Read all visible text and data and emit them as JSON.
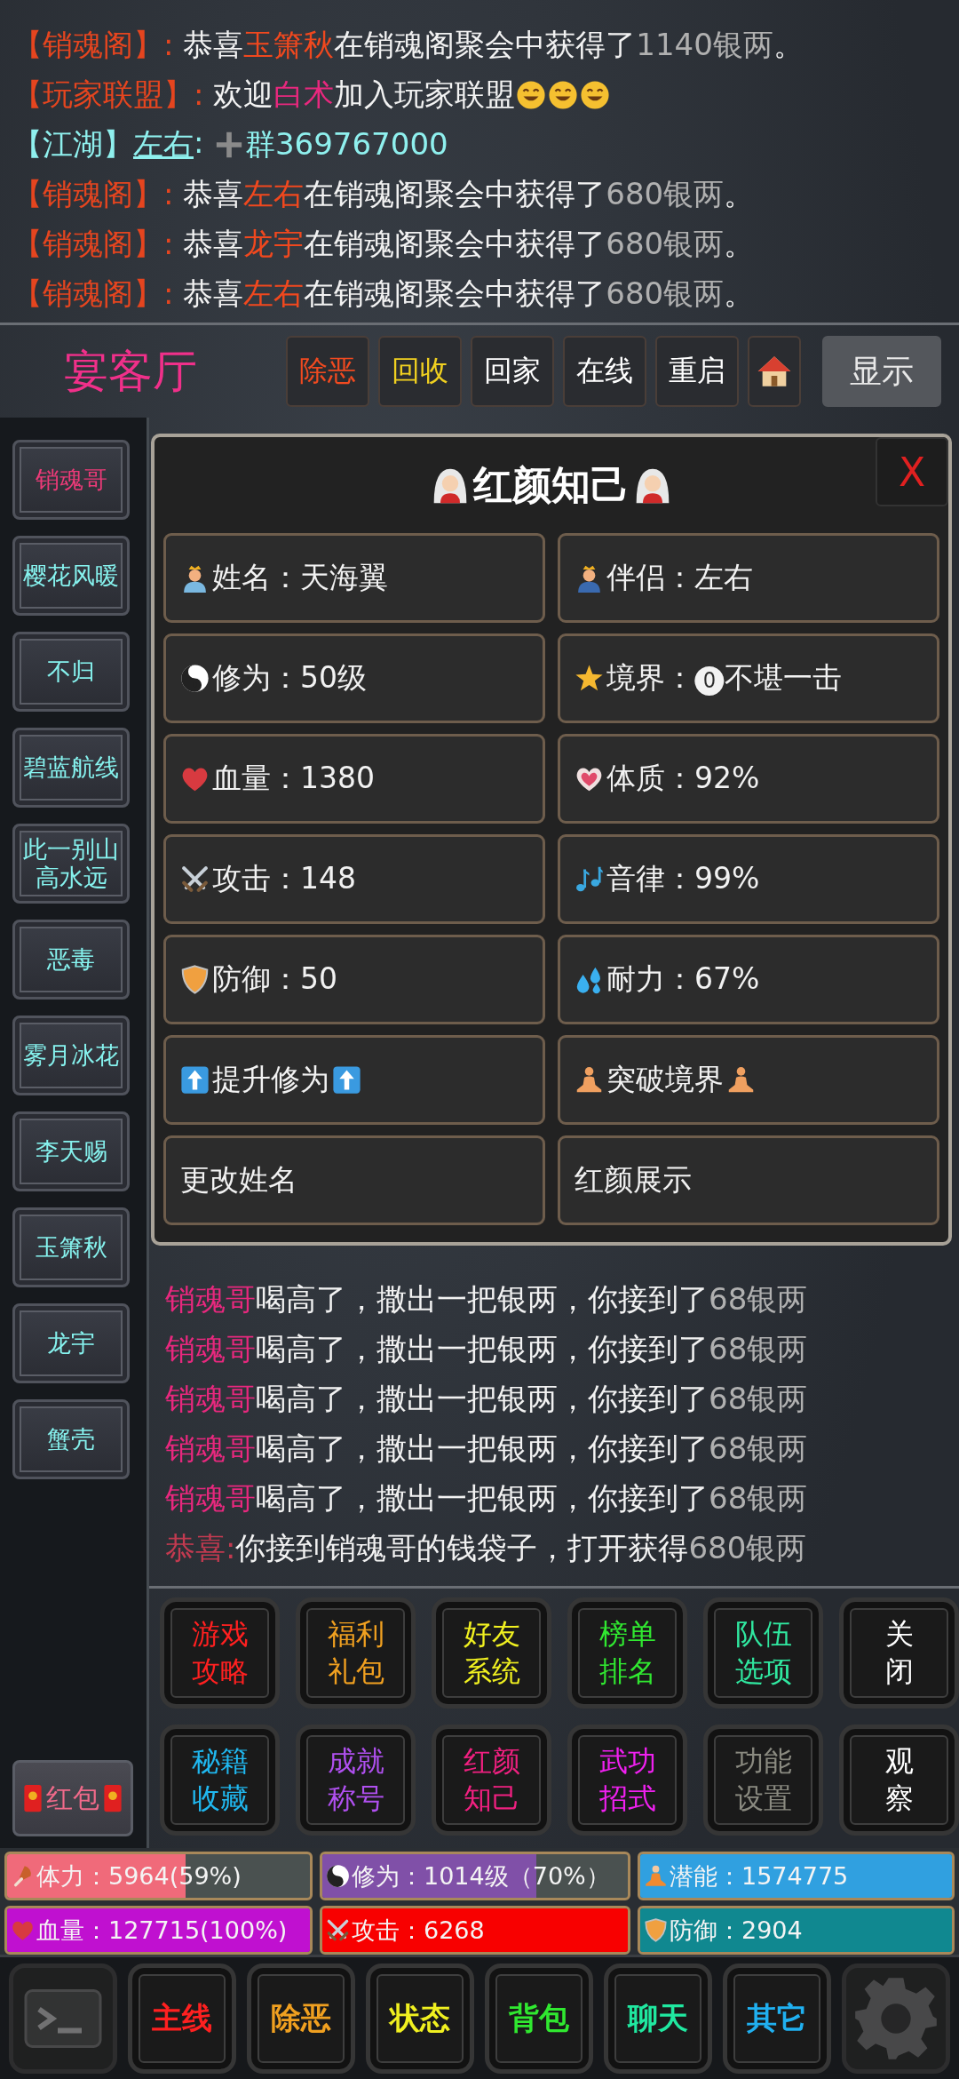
{
  "chat_top": [
    {
      "segments": [
        {
          "kind": "channel",
          "text": "【销魂阁】:"
        },
        {
          "kind": "text",
          "text": " 恭喜"
        },
        {
          "kind": "name",
          "text": "玉箫秋"
        },
        {
          "kind": "text",
          "text": "在销魂阁聚会中获得了"
        },
        {
          "kind": "amount",
          "text": "1140银两"
        },
        {
          "kind": "text",
          "text": "。"
        }
      ]
    },
    {
      "segments": [
        {
          "kind": "channel",
          "text": "【玩家联盟】:"
        },
        {
          "kind": "text",
          "text": " 欢迎"
        },
        {
          "kind": "pink-name",
          "text": "白术"
        },
        {
          "kind": "text",
          "text": "加入玩家联盟"
        },
        {
          "kind": "smiley"
        },
        {
          "kind": "smiley"
        },
        {
          "kind": "smiley"
        }
      ]
    },
    {
      "segments": [
        {
          "kind": "jianghu",
          "text": "【江湖】"
        },
        {
          "kind": "link",
          "text": "左右"
        },
        {
          "kind": "jianghu",
          "text": ": "
        },
        {
          "kind": "plus"
        },
        {
          "kind": "jianghu",
          "text": "群369767000"
        }
      ]
    },
    {
      "segments": [
        {
          "kind": "channel",
          "text": "【销魂阁】:"
        },
        {
          "kind": "text",
          "text": " 恭喜"
        },
        {
          "kind": "name",
          "text": "左右"
        },
        {
          "kind": "text",
          "text": "在销魂阁聚会中获得了"
        },
        {
          "kind": "amount",
          "text": "680银两"
        },
        {
          "kind": "text",
          "text": "。"
        }
      ]
    },
    {
      "segments": [
        {
          "kind": "channel",
          "text": "【销魂阁】:"
        },
        {
          "kind": "text",
          "text": " 恭喜"
        },
        {
          "kind": "name",
          "text": "龙宇"
        },
        {
          "kind": "text",
          "text": "在销魂阁聚会中获得了"
        },
        {
          "kind": "amount",
          "text": "680银两"
        },
        {
          "kind": "text",
          "text": "。"
        }
      ]
    },
    {
      "segments": [
        {
          "kind": "channel",
          "text": "【销魂阁】:"
        },
        {
          "kind": "text",
          "text": " 恭喜"
        },
        {
          "kind": "name",
          "text": "左右"
        },
        {
          "kind": "text",
          "text": "在销魂阁聚会中获得了"
        },
        {
          "kind": "amount",
          "text": "680银两"
        },
        {
          "kind": "text",
          "text": "。"
        }
      ]
    }
  ],
  "header": {
    "title": "宴客厅",
    "buttons": [
      {
        "label": "除恶",
        "color": "#f04a20"
      },
      {
        "label": "回收",
        "color": "#f0d020"
      },
      {
        "label": "回家",
        "color": "#ffffff"
      },
      {
        "label": "在线",
        "color": "#ffffff"
      },
      {
        "label": "重启",
        "color": "#ffffff"
      }
    ],
    "show_button": "显示"
  },
  "sidebar": {
    "items": [
      {
        "label": "销魂哥",
        "selected": true
      },
      {
        "label": "樱花风暖",
        "selected": false
      },
      {
        "label": "不归",
        "selected": false
      },
      {
        "label": "碧蓝航线",
        "selected": false
      },
      {
        "label": "此一别山高水远",
        "selected": false
      },
      {
        "label": "恶毒",
        "selected": false
      },
      {
        "label": "雾月冰花",
        "selected": false
      },
      {
        "label": "李天赐",
        "selected": false
      },
      {
        "label": "玉箫秋",
        "selected": false
      },
      {
        "label": "龙宇",
        "selected": false
      },
      {
        "label": "蟹壳",
        "selected": false
      }
    ],
    "red_packet": "红包"
  },
  "modal": {
    "title": "红颜知己",
    "close": "X",
    "cells": [
      {
        "kind": "princess",
        "text": "姓名：天海翼"
      },
      {
        "kind": "prince",
        "text": "伴侣：左右"
      },
      {
        "kind": "yinyang",
        "text": "修为：50级"
      },
      {
        "kind": "star",
        "text": "境界：⓿不堪一击"
      },
      {
        "kind": "heart",
        "text": "血量：1380"
      },
      {
        "kind": "pink-heart",
        "text": "体质：92%"
      },
      {
        "kind": "swords",
        "text": "攻击：148"
      },
      {
        "kind": "notes",
        "text": "音律：99%"
      },
      {
        "kind": "shield",
        "text": "防御：50"
      },
      {
        "kind": "drops",
        "text": "耐力：67%"
      },
      {
        "kind": "raise",
        "text": "提升修为"
      },
      {
        "kind": "breakthrough",
        "text": "突破境界"
      },
      {
        "kind": "plain",
        "text": "更改姓名"
      },
      {
        "kind": "plain",
        "text": "红颜展示"
      }
    ]
  },
  "chat_bottom": [
    {
      "segments": [
        {
          "kind": "pink-name",
          "text": "销魂哥"
        },
        {
          "kind": "text",
          "text": "喝高了，撒出一把银两，你接到了"
        },
        {
          "kind": "amount",
          "text": "68银两"
        }
      ]
    },
    {
      "segments": [
        {
          "kind": "pink-name",
          "text": "销魂哥"
        },
        {
          "kind": "text",
          "text": "喝高了，撒出一把银两，你接到了"
        },
        {
          "kind": "amount",
          "text": "68银两"
        }
      ]
    },
    {
      "segments": [
        {
          "kind": "pink-name",
          "text": "销魂哥"
        },
        {
          "kind": "text",
          "text": "喝高了，撒出一把银两，你接到了"
        },
        {
          "kind": "amount",
          "text": "68银两"
        }
      ]
    },
    {
      "segments": [
        {
          "kind": "pink-name",
          "text": "销魂哥"
        },
        {
          "kind": "text",
          "text": "喝高了，撒出一把银两，你接到了"
        },
        {
          "kind": "amount",
          "text": "68银两"
        }
      ]
    },
    {
      "segments": [
        {
          "kind": "pink-name",
          "text": "销魂哥"
        },
        {
          "kind": "text",
          "text": "喝高了，撒出一把银两，你接到了"
        },
        {
          "kind": "amount",
          "text": "68银两"
        }
      ]
    },
    {
      "segments": [
        {
          "kind": "congrats",
          "text": "恭喜:"
        },
        {
          "kind": "text",
          "text": "你接到销魂哥的钱袋子，打开获得"
        },
        {
          "kind": "amount",
          "text": "680银两"
        }
      ]
    }
  ],
  "grid_buttons": [
    {
      "label": "游戏攻略",
      "color": "#ff2020"
    },
    {
      "label": "福利礼包",
      "color": "#f0a020"
    },
    {
      "label": "好友系统",
      "color": "#f0f020"
    },
    {
      "label": "榜单排名",
      "color": "#30e830"
    },
    {
      "label": "队伍选项",
      "color": "#30e8a0"
    },
    {
      "label": "关闭",
      "color": "#ffffff"
    },
    {
      "label": "秘籍收藏",
      "color": "#20b8f0"
    },
    {
      "label": "成就称号",
      "color": "#b050f0"
    },
    {
      "label": "红颜知己",
      "color": "#f02080"
    },
    {
      "label": "武功招式",
      "color": "#f020f0"
    },
    {
      "label": "功能设置",
      "color": "#8a8a80"
    },
    {
      "label": "观察",
      "color": "#ffffff"
    }
  ],
  "stats": [
    {
      "kind": "stamina",
      "text": "体力：5964(59%)",
      "color": "#f06a7a",
      "level": 0.59
    },
    {
      "kind": "yinyang",
      "text": "修为：1014级（70%）",
      "color": "#8050a8",
      "level": 0.7
    },
    {
      "kind": "potential",
      "text": "潜能：1574775",
      "color": "#30a0e0"
    },
    {
      "kind": "heart",
      "text": "血量：127715(100%)",
      "color": "#c010d0"
    },
    {
      "kind": "swords",
      "text": "攻击：6268",
      "color": "#f80000"
    },
    {
      "kind": "shield",
      "text": "防御：2904",
      "color": "#108890"
    }
  ],
  "nav": {
    "buttons": [
      {
        "label": "主线",
        "color": "#ff2020"
      },
      {
        "label": "除恶",
        "color": "#f0a020"
      },
      {
        "label": "状态",
        "color": "#f0f020"
      },
      {
        "label": "背包",
        "color": "#30e830"
      },
      {
        "label": "聊天",
        "color": "#20e8a0"
      },
      {
        "label": "其它",
        "color": "#20b0f0"
      }
    ]
  }
}
